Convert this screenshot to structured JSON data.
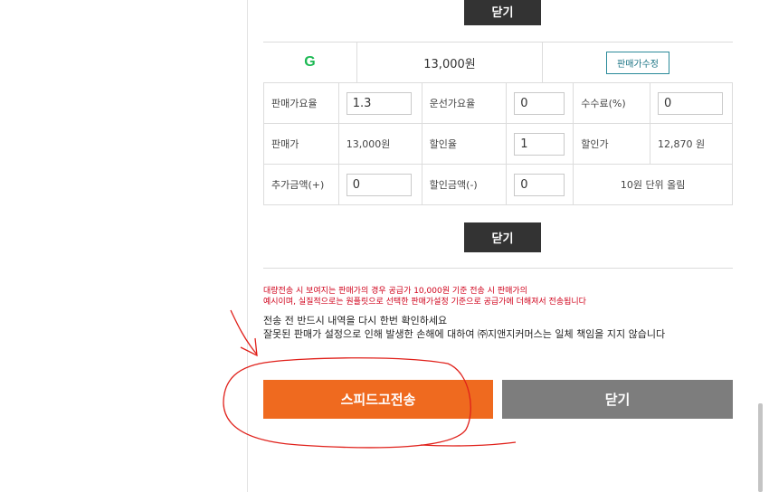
{
  "top_close_label": "닫기",
  "grade_row": {
    "icon": "G",
    "price": "13,000원",
    "edit_label": "판매가수정"
  },
  "price_table": {
    "row1": {
      "label1": "판매가요율",
      "value1": "1.3",
      "label2": "운선가요율",
      "value2": "0",
      "label3": "수수료(%)",
      "value3": "0"
    },
    "row2": {
      "label1": "판매가",
      "value1": "13,000원",
      "label2": "할인율",
      "value2": "1",
      "label3": "할인가",
      "value3": "12,870 원"
    },
    "row3": {
      "label1": "추가금액(+)",
      "value1": "0",
      "label2": "할인금액(-)",
      "value2": "0",
      "note": "10원 단위 올림"
    }
  },
  "mid_close_label": "닫기",
  "warning": {
    "line1": "대량전송 시 보여지는 판매가의 경우 공급가 10,000원 기준 전송 시 판매가의",
    "line2": "예시이며, 실질적으로는 원플릿으로 선택한 판매가설정 기준으로 공급가에 더해져서 전송됩니다"
  },
  "notice": {
    "line1": "전송 전 반드시 내역을 다시 한번 확인하세요",
    "line2": "잘못된 판매가 설정으로 인해 발생한 손해에 대하여 ㈜지앤지커머스는 일체 책임을 지지 않습니다"
  },
  "buttons": {
    "send": "스피드고전송",
    "close": "닫기"
  },
  "colors": {
    "send_bg": "#ef6a1f",
    "close_bg": "#7d7d7d",
    "dark_btn": "#333333",
    "warning": "#d0021b",
    "annotation": "#e0201a"
  }
}
